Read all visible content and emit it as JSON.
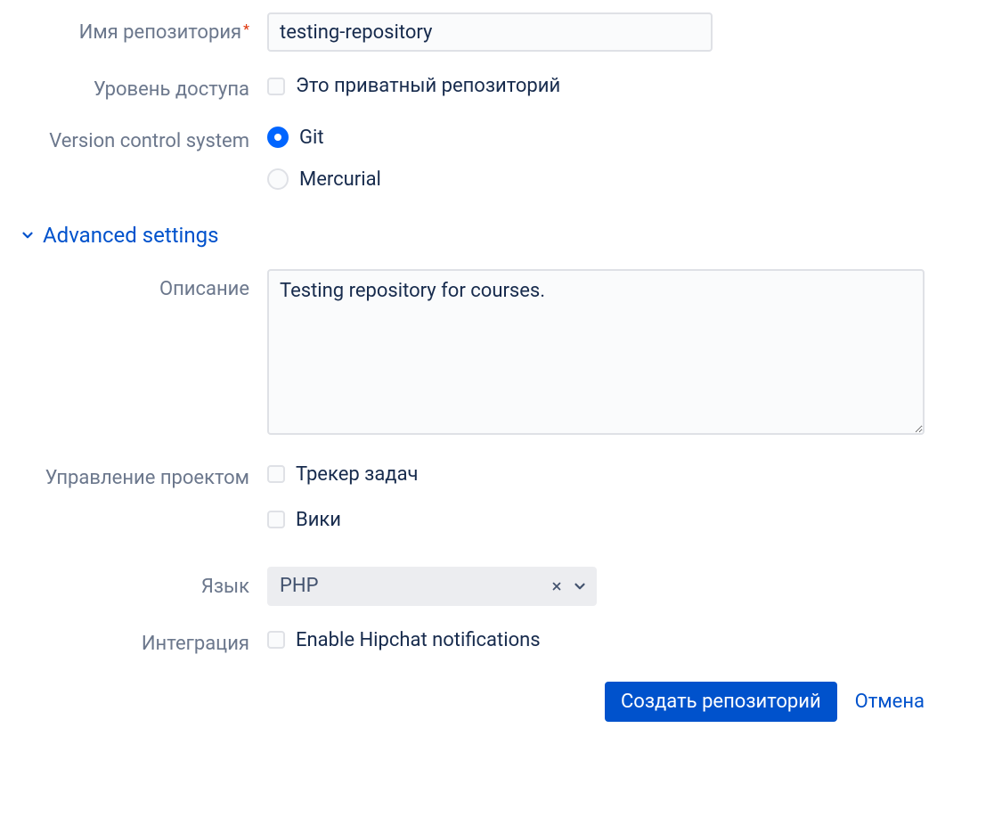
{
  "fields": {
    "repoName": {
      "label": "Имя репозитория",
      "value": "testing-repository"
    },
    "accessLevel": {
      "label": "Уровень доступа",
      "option": "Это приватный репозиторий"
    },
    "vcs": {
      "label": "Version control system",
      "option1": "Git",
      "option2": "Mercurial"
    },
    "advanced": {
      "label": "Advanced settings"
    },
    "description": {
      "label": "Описание",
      "value": "Testing repository for courses."
    },
    "projectMgmt": {
      "label": "Управление проектом",
      "option1": "Трекер задач",
      "option2": "Вики"
    },
    "language": {
      "label": "Язык",
      "value": "PHP"
    },
    "integration": {
      "label": "Интеграция",
      "option": "Enable Hipchat notifications"
    }
  },
  "buttons": {
    "submit": "Создать репозиторий",
    "cancel": "Отмена"
  }
}
